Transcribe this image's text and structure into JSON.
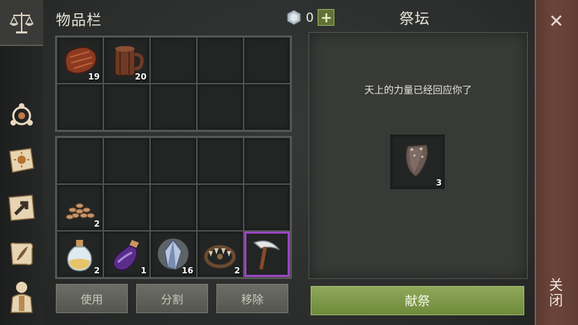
{
  "inventory": {
    "title": "物品栏",
    "currency_value": "0",
    "upper_grid": [
      {
        "icon": "steak-icon",
        "count": "19"
      },
      {
        "icon": "mug-icon",
        "count": "20"
      },
      {},
      {},
      {},
      {},
      {},
      {},
      {},
      {}
    ],
    "lower_grid": [
      {},
      {},
      {},
      {},
      {},
      {
        "icon": "seeds-icon",
        "count": "2"
      },
      {},
      {},
      {},
      {},
      {
        "icon": "potion-icon",
        "count": "2"
      },
      {
        "icon": "purple-potion-icon",
        "count": "1"
      },
      {
        "icon": "crystal-icon",
        "count": "16"
      },
      {
        "icon": "bear-trap-icon",
        "count": "2"
      },
      {
        "icon": "scythe-icon",
        "count": "",
        "selected": true
      }
    ],
    "buttons": {
      "use": "使用",
      "split": "分割",
      "remove": "移除"
    }
  },
  "altar": {
    "title": "祭坛",
    "message": "天上的力量已经回应你了",
    "slot": {
      "icon": "metal-plate-icon",
      "count": "3"
    },
    "offer_button": "献祭"
  },
  "close": {
    "label": "关闭"
  }
}
